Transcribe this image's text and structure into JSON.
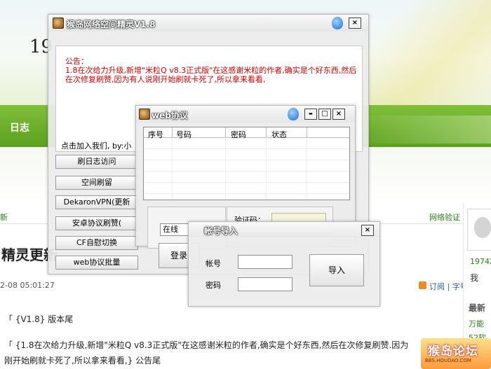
{
  "background_page": {
    "title_partial": "19",
    "nav_item": "日志",
    "link_left": "新",
    "link_right": "网络验证",
    "heading": "精灵更新",
    "date": "2-08 05:01:27",
    "meta": "订阅 | 字号",
    "para1": "「 {V1.8} 版本尾",
    "para2": "「 {1.8在次给力升级,新增\"米粒Q v8.3正式版\"在这感谢米粒的作者,确实是个好东西,然后在次修复刷赞.因为",
    "para3": "刚开始刷就卡死了,所以拿来看看,} 公告尾",
    "sidebar_num": "19742",
    "sidebar_me": "我",
    "sidebar_latest": "最新",
    "sidebar_link1": "万能",
    "sidebar_link2": "52软",
    "watermark_main": "猴岛论坛",
    "watermark_sub": "BBS.HOUDAO.COM"
  },
  "main_window": {
    "title": "猴岛网络空间精灵V1.8",
    "close": "×",
    "notice_heading": "公告：",
    "notice_body": "1.8在次给力升级,新增\"米粒Q v8.3正式版\"在这感谢米粒的作者,确实是个好东西,然后在次修复刷赞,因为有人说刚开始刷就卡死了,所以拿来看看,",
    "join_text": "点击加入我们, by:小",
    "buttons": [
      "刷日志访问",
      "空间刷留",
      "DekaronVPN(更新",
      "安卓协议刷赞(",
      "CF自慰切换",
      "web协议批量"
    ]
  },
  "web_window": {
    "title": "web协议",
    "minimize": "▬",
    "maximize": "□",
    "close": "×",
    "columns": [
      "序号",
      "号码",
      "密码",
      "状态"
    ],
    "status_select": "在线",
    "select_arrow": "▼",
    "login_button": "登录",
    "captcha_label": "验证码："
  },
  "import_window": {
    "title": "帐号导入",
    "close": "×",
    "account_label": "帐号",
    "password_label": "密码",
    "import_button": "导入"
  }
}
